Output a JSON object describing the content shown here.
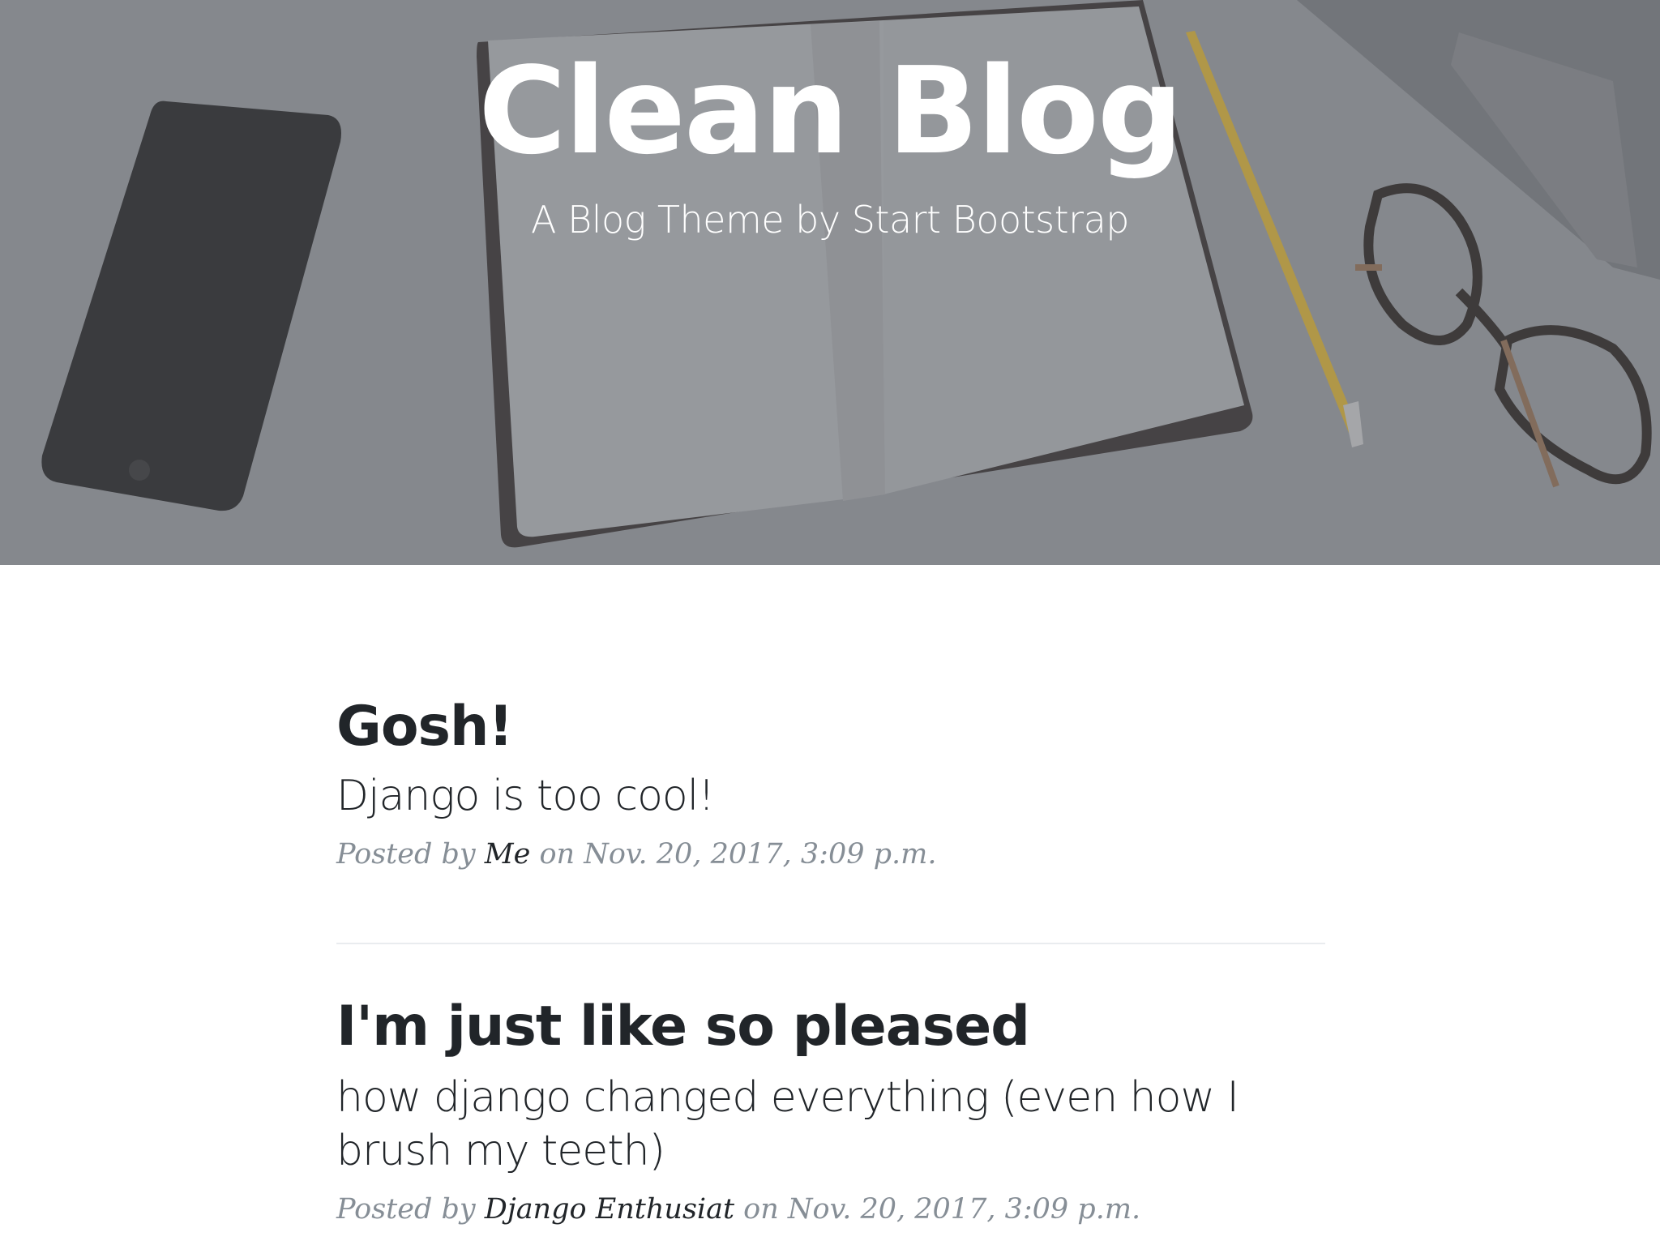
{
  "hero": {
    "title": "Clean Blog",
    "subtitle": "A Blog Theme by Start Bootstrap",
    "overlay_color": "#6c6e74"
  },
  "posts": [
    {
      "title": "Gosh!",
      "subtitle": "Django is too cool!",
      "meta_prefix": "Posted by ",
      "author": "Me",
      "meta_middle": " on ",
      "date": "Nov. 20, 2017, 3:09 p.m."
    },
    {
      "title": "I'm just like so pleased",
      "subtitle": "how django changed everything (even how I brush my teeth)",
      "meta_prefix": "Posted by ",
      "author": "Django Enthusiat",
      "meta_middle": " on ",
      "date": "Nov. 20, 2017, 3:09 p.m."
    }
  ],
  "colors": {
    "heading": "#212529",
    "meta": "#868e96",
    "divider": "#e9ecef"
  }
}
